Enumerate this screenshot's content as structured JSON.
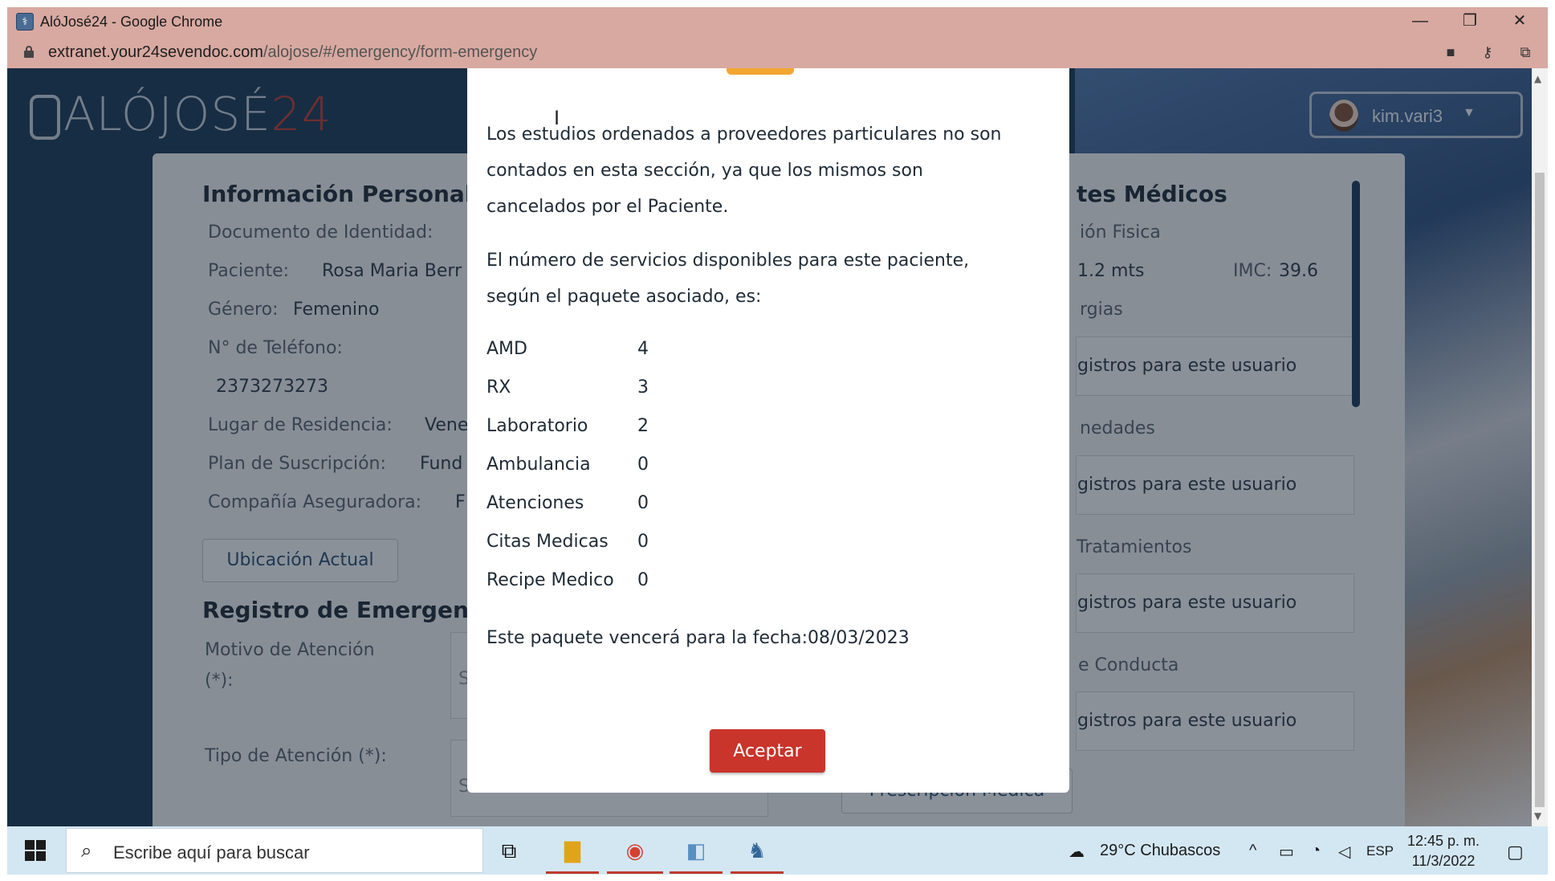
{
  "window": {
    "title": "AlóJosé24 - Google Chrome",
    "url_host": "extranet.your24sevendoc.com",
    "url_path": "/alojose/#/emergency/form-emergency"
  },
  "header": {
    "logo_text": "ALÓJOSÉ",
    "logo_num": "24",
    "user_name": "kim.vari3"
  },
  "background_form": {
    "personal_title": "Información Personal",
    "doc_label": "Documento de Identidad:",
    "patient_label": "Paciente:",
    "patient_value": "Rosa Maria Berr",
    "gender_label": "Género:",
    "gender_value": "Femenino",
    "phone_label": "N° de Teléfono:",
    "phone_value": "2373273273",
    "residence_label": "Lugar de Residencia:",
    "residence_value": "Vene",
    "plan_label": "Plan de Suscripción:",
    "plan_value": "Fund",
    "insurer_label": "Compañía Aseguradora:",
    "insurer_value": "F",
    "location_button": "Ubicación Actual",
    "emergency_title": "Registro de Emergencia",
    "reason_label": "Motivo de Atención",
    "reason_req": "(*):",
    "reason_placeholder": "Se",
    "type_label": "Tipo de Atención (*):",
    "type_placeholder": "Selecciona",
    "medical_title": "tes Médicos",
    "physical_label": "ión Fisica",
    "height_value": "1.2 mts",
    "imc_label": "IMC:",
    "imc_value": "39.6",
    "allergies_label": "rgias",
    "no_records_1": "gistros para este usuario",
    "diseases_label": "nedades",
    "no_records_2": "gistros para este usuario",
    "treatments_label": "Tratamientos",
    "no_records_3": "gistros para este usuario",
    "conduct_label": "e Conducta",
    "no_records_4": "gistros para este usuario",
    "prescription_button": "Prescripción Médica"
  },
  "modal": {
    "para1_line1": "Los estudios ordenados a proveedores particulares no son",
    "para1_line2": "contados en esta sección, ya que los mismos son",
    "para1_line3": "cancelados por el Paciente.",
    "para2_line1": "El número de servicios disponibles para este paciente,",
    "para2_line2": "según el paquete asociado, es:",
    "services": [
      {
        "name": "AMD",
        "count": "4"
      },
      {
        "name": "RX",
        "count": "3"
      },
      {
        "name": "Laboratorio",
        "count": "2"
      },
      {
        "name": "Ambulancia",
        "count": "0"
      },
      {
        "name": "Atenciones",
        "count": "0"
      },
      {
        "name": "Citas Medicas",
        "count": "0"
      },
      {
        "name": "Recipe Medico",
        "count": "0"
      }
    ],
    "expiry_text": "Este paquete vencerá para la fecha:08/03/2023",
    "accept_button": "Aceptar",
    "accent_color": "#c9342b"
  },
  "taskbar": {
    "search_placeholder": "Escribe aquí para buscar",
    "weather": "29°C  Chubascos",
    "language": "ESP",
    "time": "12:45 p. m.",
    "date": "11/3/2022"
  }
}
